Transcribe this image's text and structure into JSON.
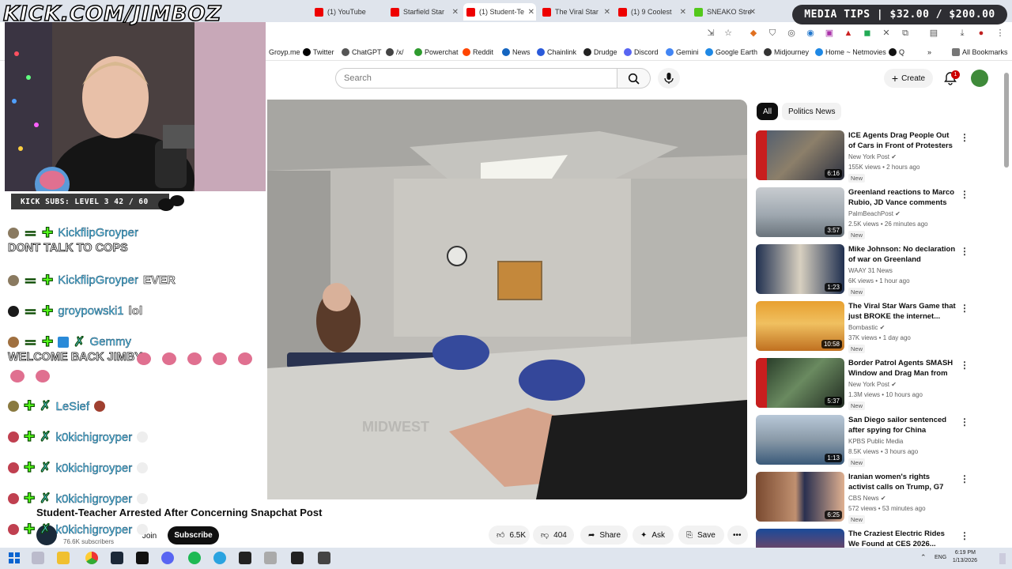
{
  "browser": {
    "tabs": [
      {
        "label": "(1) YouTube"
      },
      {
        "label": "Starfield Star"
      },
      {
        "label": "(1) Student-Te"
      },
      {
        "label": "The Viral Star"
      },
      {
        "label": "(1) 9 Coolest"
      },
      {
        "label": "SNEAKO Stre"
      }
    ],
    "bookmarks": [
      "Groyp.me",
      "Twitter",
      "ChatGPT",
      "/x/",
      "Powerchat",
      "Reddit",
      "News",
      "Chainlink",
      "Drudge",
      "Discord",
      "Gemini",
      "Google Earth",
      "Midjourney",
      "Home ~ Netmovies",
      "Q",
      "All Bookmarks"
    ]
  },
  "youtube": {
    "search_placeholder": "Search",
    "create_label": "Create",
    "notification_count": "1",
    "video": {
      "title": "Student-Teacher Arrested After Concerning Snapchat Post",
      "subscribers": "76.6K subscribers",
      "join_label": "Join",
      "subscribe_label": "Subscribe",
      "likes": "6.5K",
      "dislikes": "404",
      "share_label": "Share",
      "ask_label": "Ask",
      "save_label": "Save"
    },
    "chips": [
      "All",
      "Politics News"
    ],
    "recommendations": [
      {
        "title": "ICE Agents Drag People Out of Cars in Front of Protesters",
        "channel": "New York Post",
        "verified": true,
        "meta": "155K views • 2 hours ago",
        "duration": "6:16",
        "badge": "New"
      },
      {
        "title": "Greenland reactions to Marco Rubio, JD Vance comments on...",
        "channel": "PalmBeachPost",
        "verified": true,
        "meta": "2.5K views • 26 minutes ago",
        "duration": "3:57",
        "badge": "New"
      },
      {
        "title": "Mike Johnson: No declaration of war on Greenland",
        "channel": "WAAY 31 News",
        "verified": false,
        "meta": "6K views • 1 hour ago",
        "duration": "1:23",
        "badge": "New"
      },
      {
        "title": "The Viral Star Wars Game that just BROKE the internet...",
        "channel": "Bombastic",
        "verified": true,
        "meta": "37K views • 1 day ago",
        "duration": "10:58",
        "badge": "New"
      },
      {
        "title": "Border Patrol Agents SMASH Window and Drag Man from C...",
        "channel": "New York Post",
        "verified": true,
        "meta": "1.3M views • 10 hours ago",
        "duration": "5:37",
        "badge": "New"
      },
      {
        "title": "San Diego sailor sentenced after spying for China",
        "channel": "KPBS Public Media",
        "verified": false,
        "meta": "8.5K views • 3 hours ago",
        "duration": "1:13",
        "badge": "New"
      },
      {
        "title": "Iranian women's rights activist calls on Trump, G7 leaders to ...",
        "channel": "CBS News",
        "verified": true,
        "meta": "572 views • 53 minutes ago",
        "duration": "6:25",
        "badge": "New"
      },
      {
        "title": "The Craziest Electric Rides We Found at CES 2026...",
        "channel": "",
        "verified": false,
        "meta": "",
        "duration": "",
        "badge": ""
      }
    ]
  },
  "stream_overlay": {
    "kick_url": "KICK.COM/JIMBOZ",
    "media_tips": "MEDIA TIPS | $32.00 / $200.00",
    "kick_subs": "KICK SUBS: LEVEL 3",
    "kick_subs_progress": "42 / 60",
    "chat": [
      {
        "user": "KickflipGroyper",
        "message": ""
      },
      {
        "user": "",
        "message": "DONT TALK TO COPS"
      },
      {
        "user": "KickflipGroyper",
        "message": "EVER"
      },
      {
        "user": "groypowski1",
        "message": "lol"
      },
      {
        "user": "Gemmy",
        "message": ""
      },
      {
        "user": "",
        "message": "WELCOME BACK JIMBY"
      },
      {
        "user": "LeSief",
        "message": ""
      },
      {
        "user": "k0kichigroyper",
        "message": ""
      },
      {
        "user": "k0kichigroyper",
        "message": ""
      },
      {
        "user": "k0kichigroyper",
        "message": ""
      },
      {
        "user": "k0kichigroyper",
        "message": ""
      }
    ]
  },
  "taskbar": {
    "lang": "ENG",
    "time": "6:19 PM",
    "date": "1/13/2026"
  }
}
